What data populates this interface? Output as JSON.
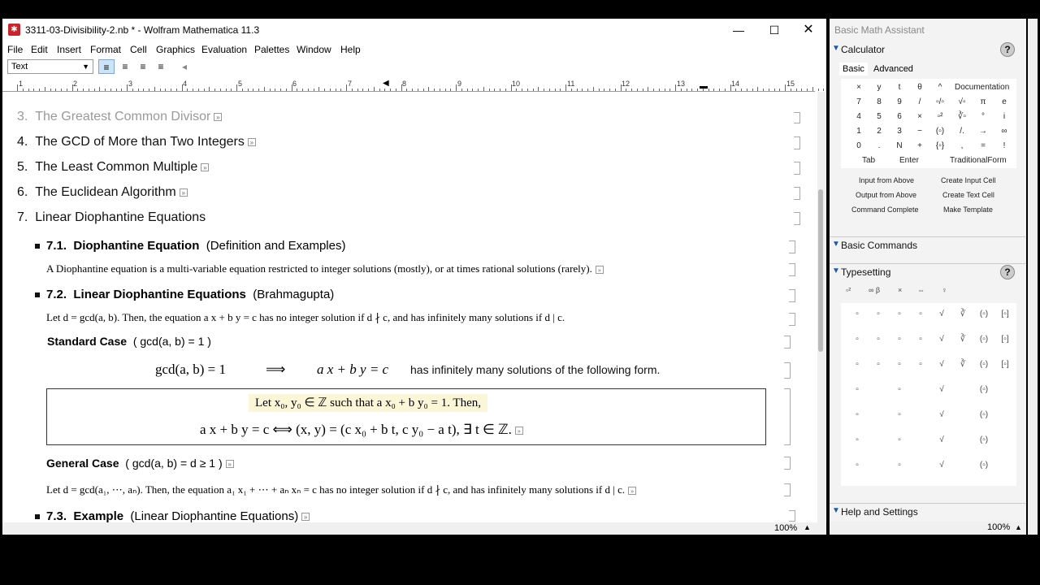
{
  "window": {
    "title": "3311-03-Divisibility-2.nb * - Wolfram Mathematica 11.3",
    "icon": "mathematica-icon"
  },
  "menu": [
    "File",
    "Edit",
    "Insert",
    "Format",
    "Cell",
    "Graphics",
    "Evaluation",
    "Palettes",
    "Window",
    "Help"
  ],
  "toolbar": {
    "style_value": "Text"
  },
  "ruler_labels": [
    "1",
    "2",
    "3",
    "4",
    "5",
    "6",
    "7",
    "8",
    "9",
    "10",
    "11",
    "12",
    "13",
    "14",
    "15"
  ],
  "sections": [
    {
      "num": "3.",
      "title": "The Greatest Common Divisor"
    },
    {
      "num": "4.",
      "title": "The GCD of More than Two Integers"
    },
    {
      "num": "5.",
      "title": "The Least Common Multiple"
    },
    {
      "num": "6.",
      "title": "The Euclidean Algorithm"
    },
    {
      "num": "7.",
      "title": "Linear Diophantine Equations"
    }
  ],
  "sub71": {
    "num": "7.1.",
    "title": "Diophantine Equation",
    "paren": "(Definition and Examples)"
  },
  "text71": "A Diophantine equation is a multi-variable equation restricted to integer solutions (mostly), or at times rational solutions (rarely).",
  "sub72": {
    "num": "7.2.",
    "title": "Linear Diophantine Equations",
    "paren": "(Brahmagupta)"
  },
  "text72": "Let  d = gcd(a, b).  Then, the equation  a x + b y = c  has no integer solution if  d ∤ c,  and has infinitely many solutions if  d | c.",
  "std": {
    "title": "Standard Case",
    "cond": "( gcd(a, b) = 1 )"
  },
  "stdmath": {
    "lhs": "gcd(a, b) = 1",
    "arrow": "⟹",
    "eq": "a x + b y = c",
    "desc": "has infinitely many solutions of the following form."
  },
  "boxline1": "Let   x₀, y₀ ∈ ℤ   such that   a x₀ + b y₀ = 1.   Then,",
  "boxline2": "a x + b y = c      ⟺      (x, y) = (c x₀ + b t,  c y₀ − a t),   ∃ t ∈ ℤ.",
  "gen": {
    "title": "General Case",
    "cond": "( gcd(a, b) = d ≥ 1 )"
  },
  "textgen": "Let  d = gcd(a₁, ⋯, aₙ).  Then, the equation  a₁ x₁ + ⋯ + aₙ xₙ = c  has no integer solution if  d ∤ c,  and has infinitely many solutions if  d | c.",
  "sub73": {
    "num": "7.3.",
    "title": "Example",
    "paren": "(Linear Diophantine Equations)"
  },
  "status": {
    "zoom": "100%"
  },
  "palette": {
    "title": "Basic Math Assistant",
    "calculator": "Calculator",
    "tabs": [
      "Basic",
      "Advanced"
    ],
    "keys": [
      [
        "×",
        "y",
        "t",
        "θ",
        "^"
      ],
      [
        "7",
        "8",
        "9",
        "/",
        "▫/▫"
      ],
      [
        "4",
        "5",
        "6",
        "×",
        "▫²"
      ],
      [
        "1",
        "2",
        "3",
        "−",
        "(▫)"
      ],
      [
        "0",
        ".",
        "N",
        "+",
        "{▫}"
      ]
    ],
    "keys2": [
      [
        "√▫",
        "π",
        "e"
      ],
      [
        "∛▫",
        "°",
        "i"
      ],
      [
        "/.",
        "→",
        "∞"
      ],
      [
        ",",
        "=",
        "!"
      ]
    ],
    "documentation": "Documentation",
    "tab_key": "Tab",
    "enter_key": "Enter",
    "traditional": "TraditionalForm",
    "commands": [
      "Input from Above",
      "Create Input Cell",
      "Output from Above",
      "Create Text Cell",
      "Command Complete",
      "Make Template"
    ],
    "basic_commands": "Basic Commands",
    "typesetting": "Typesetting",
    "ts_tabs": [
      "▫²",
      "∞ β",
      "×",
      "⇔",
      "♀"
    ],
    "help_settings": "Help and Settings",
    "zoom": "100%"
  }
}
